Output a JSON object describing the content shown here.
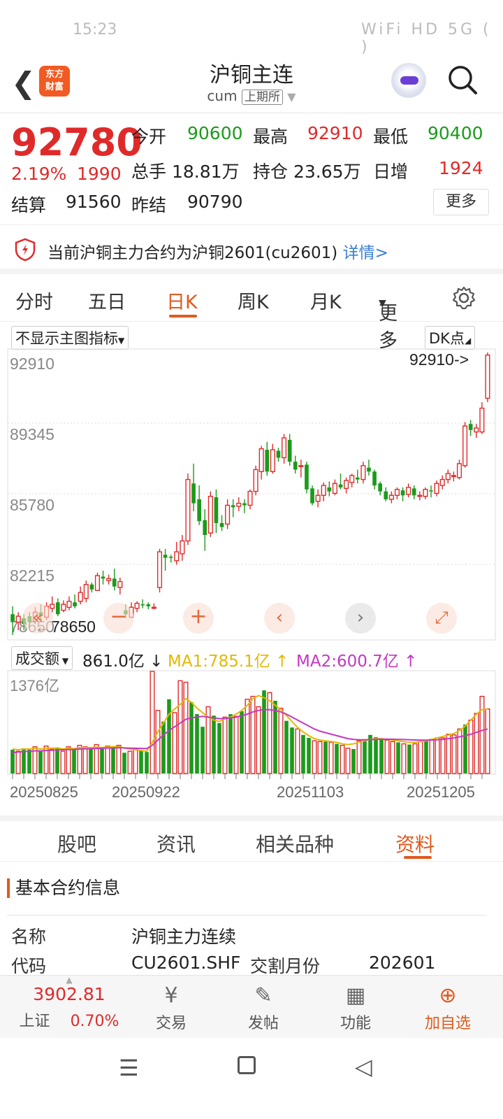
{
  "status_bar": {
    "time": "15:23",
    "icons": "WiFi HD 5G ( )"
  },
  "header": {
    "title": "沪铜主连",
    "code": "cum",
    "exchange": "上期所",
    "logo_text_line1": "东方",
    "logo_text_line2": "财富"
  },
  "quote": {
    "price": "92780",
    "change_pct": "2.19%",
    "change": "1990",
    "open_label": "今开",
    "open": "90600",
    "high_label": "最高",
    "high": "92910",
    "low_label": "最低",
    "low": "90400",
    "volume_label": "总手",
    "volume": "18.81万",
    "oi_label": "持仓",
    "oi": "23.65万",
    "daily_inc_label": "日增",
    "daily_inc": "1924",
    "settle_label": "结算",
    "settle": "91560",
    "prev_settle_label": "昨结",
    "prev_settle": "90790",
    "more_label": "更多"
  },
  "notice": {
    "text": "当前沪铜主力合约为沪铜2601(cu2601)",
    "link": "详情>"
  },
  "tabs": [
    "分时",
    "五日",
    "日K",
    "周K",
    "月K",
    "更多"
  ],
  "active_tab": "日K",
  "chart_controls": {
    "indicator_dropdown": "不显示主图指标",
    "dk_button": "DK点"
  },
  "chart_data": {
    "type": "candlestick",
    "y_ticks": [
      "92910",
      "89345",
      "85780",
      "82215",
      "78650"
    ],
    "ylim": [
      78650,
      92910
    ],
    "max_annotation": "92910->",
    "min_annotation": "78650",
    "x_ticks": [
      "20250825",
      "20250922",
      "20251103",
      "20251205"
    ],
    "candles": [
      [
        79700,
        79350,
        80100,
        78650
      ],
      [
        79300,
        79600,
        79800,
        78900
      ],
      [
        79500,
        79200,
        79700,
        78900
      ],
      [
        79600,
        79300,
        79800,
        79000
      ],
      [
        79350,
        79800,
        80050,
        79200
      ],
      [
        79800,
        79600,
        80200,
        79400
      ],
      [
        79550,
        80100,
        80300,
        79400
      ],
      [
        80000,
        80200,
        80600,
        79800
      ],
      [
        80300,
        79700,
        80500,
        79600
      ],
      [
        79900,
        80200,
        80400,
        79800
      ],
      [
        80050,
        80350,
        80600,
        79900
      ],
      [
        80300,
        80100,
        80700,
        80000
      ],
      [
        80350,
        80800,
        81100,
        80200
      ],
      [
        80500,
        81200,
        81400,
        80300
      ],
      [
        81200,
        80950,
        81300,
        80800
      ],
      [
        80900,
        81650,
        81800,
        80900
      ],
      [
        81600,
        81500,
        81900,
        81200
      ],
      [
        81400,
        81500,
        81700,
        81200
      ],
      [
        81500,
        81100,
        82000,
        80900
      ],
      [
        81050,
        81350,
        81550,
        80700
      ],
      [
        79900,
        79700,
        80200,
        79500
      ],
      [
        79550,
        80050,
        80300,
        79500
      ],
      [
        80000,
        80250,
        80350,
        79800
      ],
      [
        80200,
        80150,
        80450,
        80000
      ],
      [
        80200,
        80100,
        80300,
        79950
      ],
      [
        80050,
        80050,
        80250,
        79950
      ],
      [
        81050,
        82850,
        83000,
        80800
      ],
      [
        82700,
        82550,
        83000,
        81900
      ],
      [
        82600,
        82550,
        82700,
        82300
      ],
      [
        82400,
        82850,
        83350,
        82200
      ],
      [
        82750,
        83400,
        83700,
        82400
      ],
      [
        83400,
        86500,
        86800,
        83200
      ],
      [
        86300,
        85300,
        87300,
        84900
      ],
      [
        85500,
        84400,
        86200,
        84200
      ],
      [
        84450,
        83700,
        85000,
        82900
      ],
      [
        83800,
        85650,
        85900,
        83600
      ],
      [
        85600,
        84300,
        86000,
        83800
      ],
      [
        84300,
        84100,
        84700,
        83900
      ],
      [
        84250,
        85200,
        85500,
        84000
      ],
      [
        85200,
        85100,
        85500,
        84600
      ],
      [
        85150,
        85300,
        85600,
        84900
      ],
      [
        85300,
        85200,
        85500,
        84800
      ],
      [
        85200,
        85900,
        86000,
        85000
      ],
      [
        85900,
        87000,
        87200,
        85700
      ],
      [
        86900,
        88050,
        88200,
        86500
      ],
      [
        88000,
        86900,
        88400,
        86700
      ],
      [
        86900,
        88000,
        88300,
        86800
      ],
      [
        87950,
        87600,
        88100,
        87400
      ],
      [
        87600,
        88600,
        88800,
        87300
      ],
      [
        88500,
        87400,
        88800,
        87200
      ],
      [
        87400,
        87000,
        87700,
        86800
      ],
      [
        87200,
        87200,
        87500,
        86600
      ],
      [
        87250,
        86000,
        87400,
        85800
      ],
      [
        86050,
        85300,
        86200,
        85200
      ],
      [
        85400,
        85700,
        86000,
        85100
      ],
      [
        85700,
        86200,
        86350,
        85400
      ],
      [
        86100,
        85900,
        86400,
        85650
      ],
      [
        85800,
        86300,
        86500,
        85700
      ],
      [
        86250,
        86100,
        86800,
        86000
      ],
      [
        86050,
        86450,
        86600,
        85800
      ],
      [
        86350,
        86700,
        86800,
        86100
      ],
      [
        86600,
        86500,
        87000,
        86300
      ],
      [
        86500,
        87200,
        87400,
        86300
      ],
      [
        87100,
        86900,
        87500,
        86700
      ],
      [
        86900,
        86200,
        87000,
        86000
      ],
      [
        86300,
        85900,
        86400,
        85700
      ],
      [
        85900,
        85500,
        86100,
        85400
      ],
      [
        85500,
        85700,
        85900,
        85300
      ],
      [
        85700,
        86000,
        86100,
        85500
      ],
      [
        85950,
        85700,
        86100,
        85400
      ],
      [
        85750,
        86100,
        86300,
        85600
      ],
      [
        86050,
        85700,
        86200,
        85500
      ],
      [
        85700,
        85700,
        85900,
        85450
      ],
      [
        85650,
        86000,
        86100,
        85500
      ],
      [
        85950,
        85900,
        86200,
        85600
      ],
      [
        85800,
        86300,
        86450,
        85650
      ],
      [
        86200,
        86500,
        86700,
        86000
      ],
      [
        86500,
        86800,
        87000,
        86300
      ],
      [
        86700,
        86700,
        86900,
        86400
      ],
      [
        86600,
        87300,
        87500,
        86500
      ],
      [
        87200,
        89200,
        89400,
        87100
      ],
      [
        89300,
        89000,
        89500,
        88700
      ],
      [
        88900,
        89100,
        89300,
        88600
      ],
      [
        88900,
        90100,
        90400,
        88800
      ],
      [
        90600,
        92780,
        92910,
        90400
      ]
    ],
    "ohlc_order": [
      "open",
      "close",
      "high",
      "low"
    ]
  },
  "volume_indicator": {
    "label": "成交额",
    "value": "861.0亿",
    "ma1": "MA1:785.1亿",
    "ma2": "MA2:600.7亿",
    "y_max_label": "1376亿",
    "ylim": [
      0,
      1376
    ],
    "values": [
      320,
      300,
      340,
      320,
      360,
      310,
      370,
      330,
      350,
      300,
      360,
      330,
      380,
      360,
      350,
      390,
      340,
      370,
      360,
      380,
      280,
      300,
      330,
      310,
      290,
      1376,
      850,
      700,
      1000,
      820,
      1250,
      1230,
      960,
      800,
      630,
      900,
      780,
      680,
      760,
      800,
      770,
      840,
      1000,
      1040,
      900,
      1120,
      1090,
      980,
      880,
      710,
      620,
      600,
      520,
      480,
      440,
      430,
      430,
      420,
      400,
      380,
      340,
      330,
      440,
      450,
      520,
      490,
      460,
      450,
      430,
      420,
      400,
      390,
      400,
      430,
      450,
      460,
      480,
      480,
      530,
      520,
      600,
      660,
      720,
      810,
      1040,
      870
    ],
    "ma1_values": [
      330,
      320,
      330,
      330,
      340,
      330,
      340,
      340,
      345,
      330,
      340,
      335,
      350,
      350,
      350,
      355,
      350,
      360,
      360,
      365,
      340,
      330,
      320,
      310,
      300,
      420,
      560,
      680,
      800,
      870,
      930,
      1010,
      960,
      880,
      820,
      760,
      720,
      700,
      740,
      760,
      800,
      850,
      920,
      1010,
      1050,
      1020,
      980,
      920,
      860,
      780,
      700,
      620,
      560,
      510,
      470,
      450,
      440,
      430,
      420,
      400,
      390,
      400,
      420,
      440,
      460,
      470,
      470,
      460,
      450,
      440,
      430,
      420,
      420,
      430,
      440,
      460,
      480,
      500,
      520,
      540,
      580,
      640,
      720,
      800,
      860,
      870
    ],
    "ma2_values": [
      280,
      290,
      295,
      300,
      305,
      305,
      310,
      315,
      318,
      320,
      322,
      325,
      330,
      332,
      335,
      338,
      340,
      343,
      345,
      348,
      345,
      342,
      340,
      338,
      336,
      380,
      450,
      520,
      580,
      630,
      680,
      730,
      750,
      760,
      770,
      760,
      750,
      740,
      740,
      750,
      760,
      780,
      800,
      830,
      850,
      860,
      860,
      850,
      830,
      800,
      760,
      720,
      680,
      640,
      600,
      570,
      550,
      530,
      510,
      490,
      470,
      460,
      455,
      455,
      458,
      460,
      462,
      463,
      462,
      460,
      458,
      455,
      452,
      450,
      450,
      452,
      455,
      460,
      470,
      480,
      495,
      510,
      530,
      555,
      580,
      600
    ]
  },
  "sub_tabs": [
    "股吧",
    "资讯",
    "相关品种",
    "资料"
  ],
  "active_sub_tab": "资料",
  "contract_info": {
    "section_title": "基本合约信息",
    "name_label": "名称",
    "name": "沪铜主力连续",
    "code_label": "代码",
    "code": "CU2601.SHF",
    "delivery_label": "交割月份",
    "delivery": "202601"
  },
  "bottom_bar": {
    "index_value": "3902.81",
    "index_name": "上证",
    "index_change": "0.70%",
    "trade": "交易",
    "post": "发帖",
    "functions": "功能",
    "add_watch": "加自选"
  },
  "colors": {
    "up": "#e02a2a",
    "down": "#1b9b1b",
    "accent": "#e05a1e",
    "link": "#3a7fd6"
  }
}
